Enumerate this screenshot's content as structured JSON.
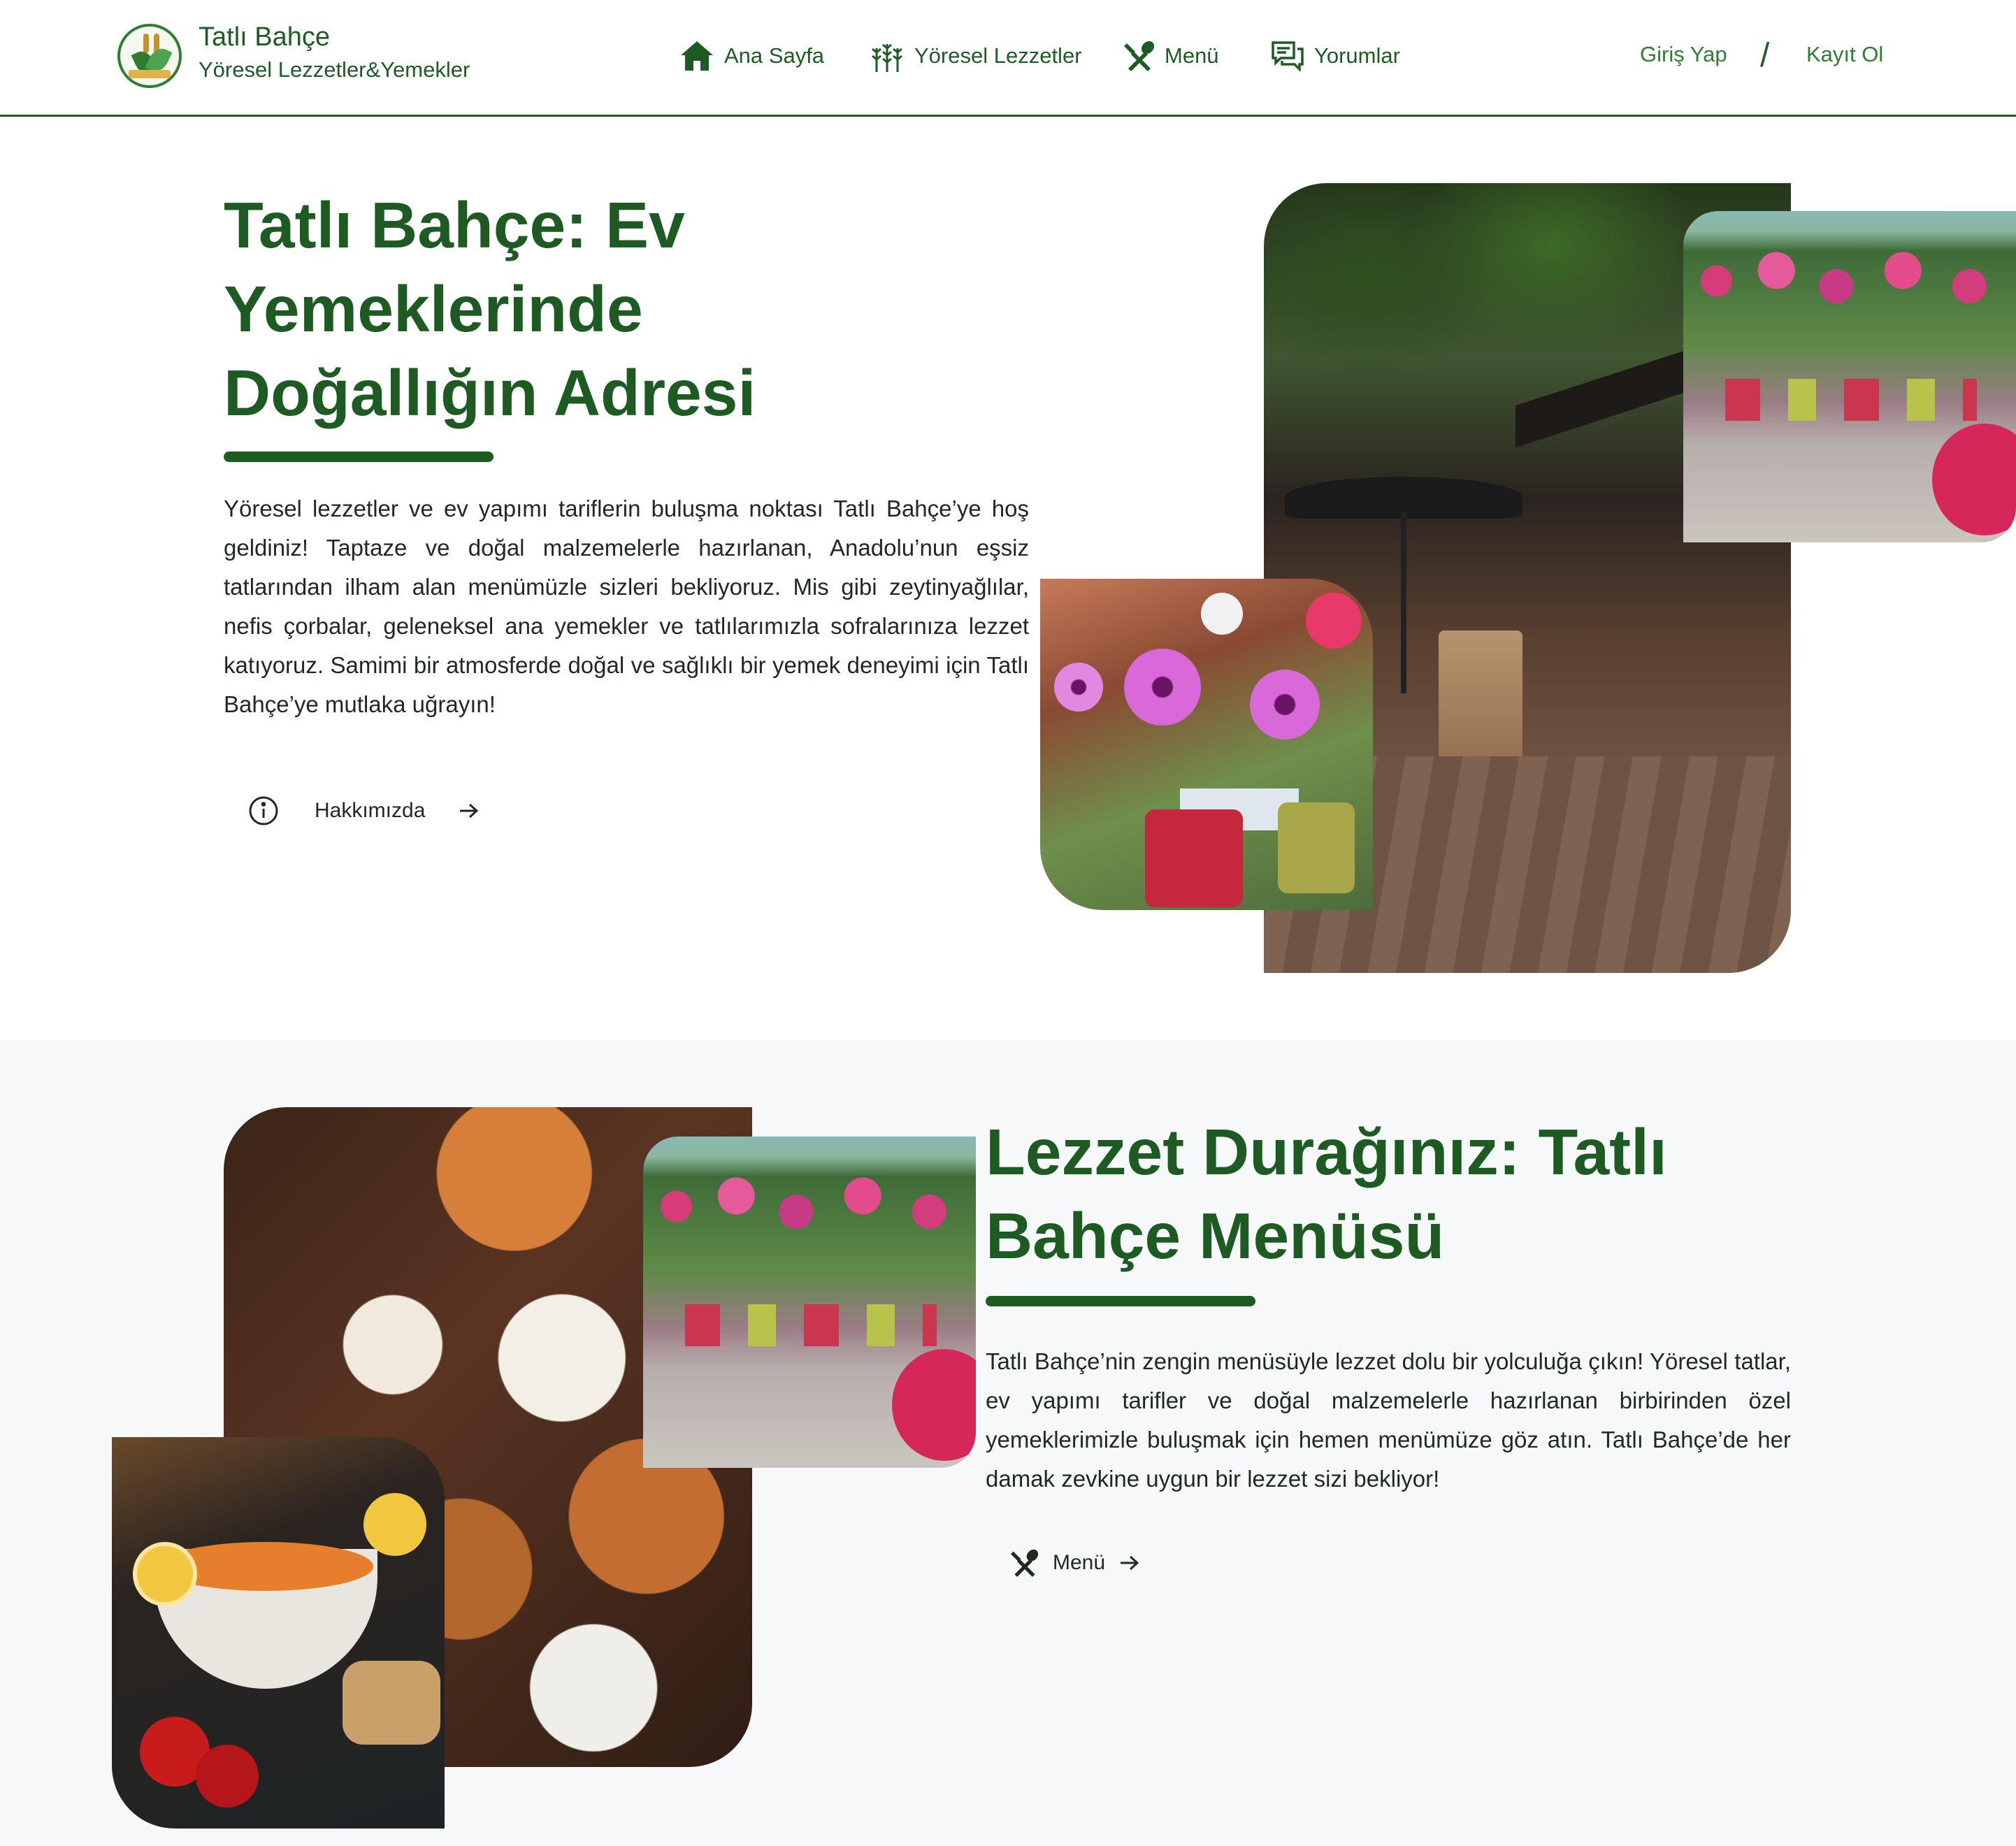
{
  "header": {
    "brand": {
      "title": "Tatlı Bahçe",
      "subtitle": "Yöresel Lezzetler&Yemekler"
    },
    "nav": [
      {
        "label": "Ana Sayfa",
        "icon": "home-icon"
      },
      {
        "label": "Yöresel Lezzetler",
        "icon": "wheat-icon"
      },
      {
        "label": "Menü",
        "icon": "fork-spoon-icon"
      },
      {
        "label": "Yorumlar",
        "icon": "comments-icon"
      }
    ],
    "auth": {
      "login": "Giriş Yap",
      "separator": "/",
      "register": "Kayıt Ol"
    }
  },
  "hero": {
    "title": "Tatlı Bahçe: Ev Yemeklerinde Doğallığın Adresi",
    "text": "Yöresel lezzetler ve ev yapımı tariflerin buluşma noktası Tatlı Bahçe’ye hoş geldiniz! Taptaze ve doğal malzemelerle hazırlanan, Anadolu’nun eşsiz tatlarından ilham alan menümüzle sizleri bekliyoruz. Mis gibi zeytinyağlılar, nefis çorbalar, geleneksel ana yemekler ve tatlılarımızla sofralarınıza lezzet katıyoruz. Samimi bir atmosferde doğal ve sağlıklı bir yemek deneyimi için Tatlı Bahçe’ye mutlaka uğrayın!",
    "button": {
      "label": "Hakkımızda",
      "icon": "info-icon",
      "arrow": "arrow-right-icon"
    }
  },
  "menu_section": {
    "title": "Lezzet Durağınız: Tatlı Bahçe Menüsü",
    "text": "Tatlı Bahçe’nin zengin menüsüyle lezzet dolu bir yolculuğa çıkın! Yöresel tatlar, ev yapımı tarifler ve doğal malzemelerle hazırlanan birbirinden özel yemeklerimizle buluşmak için hemen menümüze göz atın. Tatlı Bahçe’de her damak zevkine uygun bir lezzet sizi bekliyor!",
    "button": {
      "label": "Menü",
      "icon": "fork-spoon-icon",
      "arrow": "arrow-right-icon"
    }
  },
  "colors": {
    "brand_green": "#1d5b22",
    "accent_green": "#2f7d32",
    "section_bg": "#f7f8fa"
  }
}
